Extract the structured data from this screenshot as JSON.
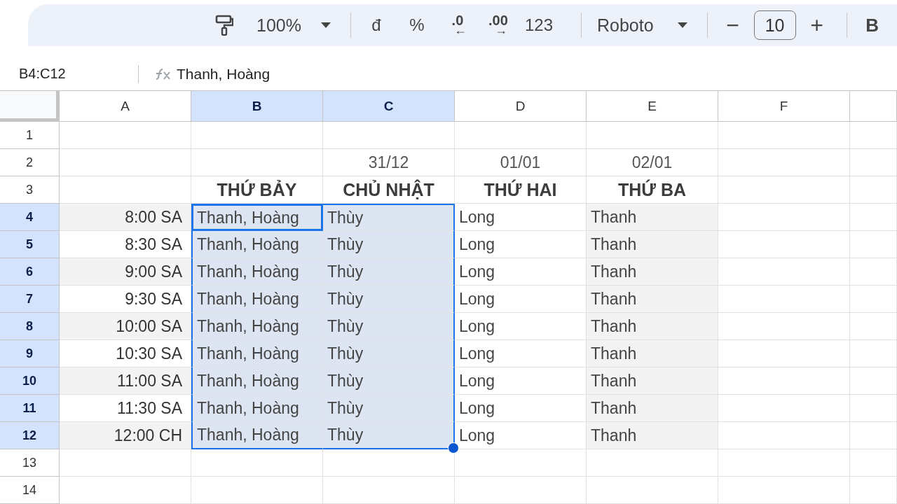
{
  "toolbar": {
    "zoom": "100%",
    "format_buttons": [
      {
        "kind": "text",
        "label": "đ"
      },
      {
        "kind": "text",
        "label": "%"
      },
      {
        "kind": "decimal",
        "label": ".0",
        "arrow": "←"
      },
      {
        "kind": "decimal",
        "label": ".00",
        "arrow": "→"
      },
      {
        "kind": "text",
        "label": "123"
      }
    ],
    "font": "Roboto",
    "size_minus": "−",
    "font_size": "10",
    "size_plus": "+",
    "bold": "B"
  },
  "formula_bar": {
    "name_box": "B4:C12",
    "value": "Thanh, Hoàng"
  },
  "columns": [
    {
      "label": "A",
      "selected": false
    },
    {
      "label": "B",
      "selected": true
    },
    {
      "label": "C",
      "selected": true
    },
    {
      "label": "D",
      "selected": false
    },
    {
      "label": "E",
      "selected": false
    },
    {
      "label": "F",
      "selected": false
    }
  ],
  "rows": [
    {
      "number": "1",
      "selected": false,
      "cells": [
        "",
        "",
        "",
        "",
        "",
        ""
      ]
    },
    {
      "number": "2",
      "selected": false,
      "kind": "date",
      "cells": [
        "",
        "",
        "31/12",
        "01/01",
        "02/01",
        ""
      ]
    },
    {
      "number": "3",
      "selected": false,
      "kind": "heading",
      "cells": [
        "",
        "THỨ BẢY",
        "CHỦ NHẬT",
        "THỨ HAI",
        "THỨ BA",
        ""
      ]
    },
    {
      "number": "4",
      "selected": true,
      "active": true,
      "cells": [
        {
          "text": "8:00 SA",
          "shaded": true
        },
        "Thanh, Hoàng",
        "Thùy",
        "Long",
        {
          "text": "Thanh",
          "shaded": true
        },
        ""
      ]
    },
    {
      "number": "5",
      "selected": true,
      "cells": [
        {
          "text": "8:30 SA",
          "shaded": false
        },
        "Thanh, Hoàng",
        "Thùy",
        "Long",
        {
          "text": "Thanh",
          "shaded": true
        },
        ""
      ]
    },
    {
      "number": "6",
      "selected": true,
      "cells": [
        {
          "text": "9:00 SA",
          "shaded": true
        },
        "Thanh, Hoàng",
        "Thùy",
        "Long",
        {
          "text": "Thanh",
          "shaded": true
        },
        ""
      ]
    },
    {
      "number": "7",
      "selected": true,
      "cells": [
        {
          "text": "9:30 SA",
          "shaded": false
        },
        "Thanh, Hoàng",
        "Thùy",
        "Long",
        {
          "text": "Thanh",
          "shaded": true
        },
        ""
      ]
    },
    {
      "number": "8",
      "selected": true,
      "cells": [
        {
          "text": "10:00 SA",
          "shaded": true
        },
        "Thanh, Hoàng",
        "Thùy",
        "Long",
        {
          "text": "Thanh",
          "shaded": true
        },
        ""
      ]
    },
    {
      "number": "9",
      "selected": true,
      "cells": [
        {
          "text": "10:30 SA",
          "shaded": false
        },
        "Thanh, Hoàng",
        "Thùy",
        "Long",
        {
          "text": "Thanh",
          "shaded": true
        },
        ""
      ]
    },
    {
      "number": "10",
      "selected": true,
      "cells": [
        {
          "text": "11:00 SA",
          "shaded": true
        },
        "Thanh, Hoàng",
        "Thùy",
        "Long",
        {
          "text": "Thanh",
          "shaded": true
        },
        ""
      ]
    },
    {
      "number": "11",
      "selected": true,
      "cells": [
        {
          "text": "11:30 SA",
          "shaded": false
        },
        "Thanh, Hoàng",
        "Thùy",
        "Long",
        {
          "text": "Thanh",
          "shaded": true
        },
        ""
      ]
    },
    {
      "number": "12",
      "selected": true,
      "cells": [
        {
          "text": "12:00 CH",
          "shaded": true
        },
        "Thanh, Hoàng",
        "Thùy",
        "Long",
        {
          "text": "Thanh",
          "shaded": true
        },
        ""
      ]
    },
    {
      "number": "13",
      "selected": false,
      "cells": [
        "",
        "",
        "",
        "",
        "",
        ""
      ]
    },
    {
      "number": "14",
      "selected": false,
      "cells": [
        "",
        "",
        "",
        "",
        "",
        ""
      ]
    }
  ]
}
